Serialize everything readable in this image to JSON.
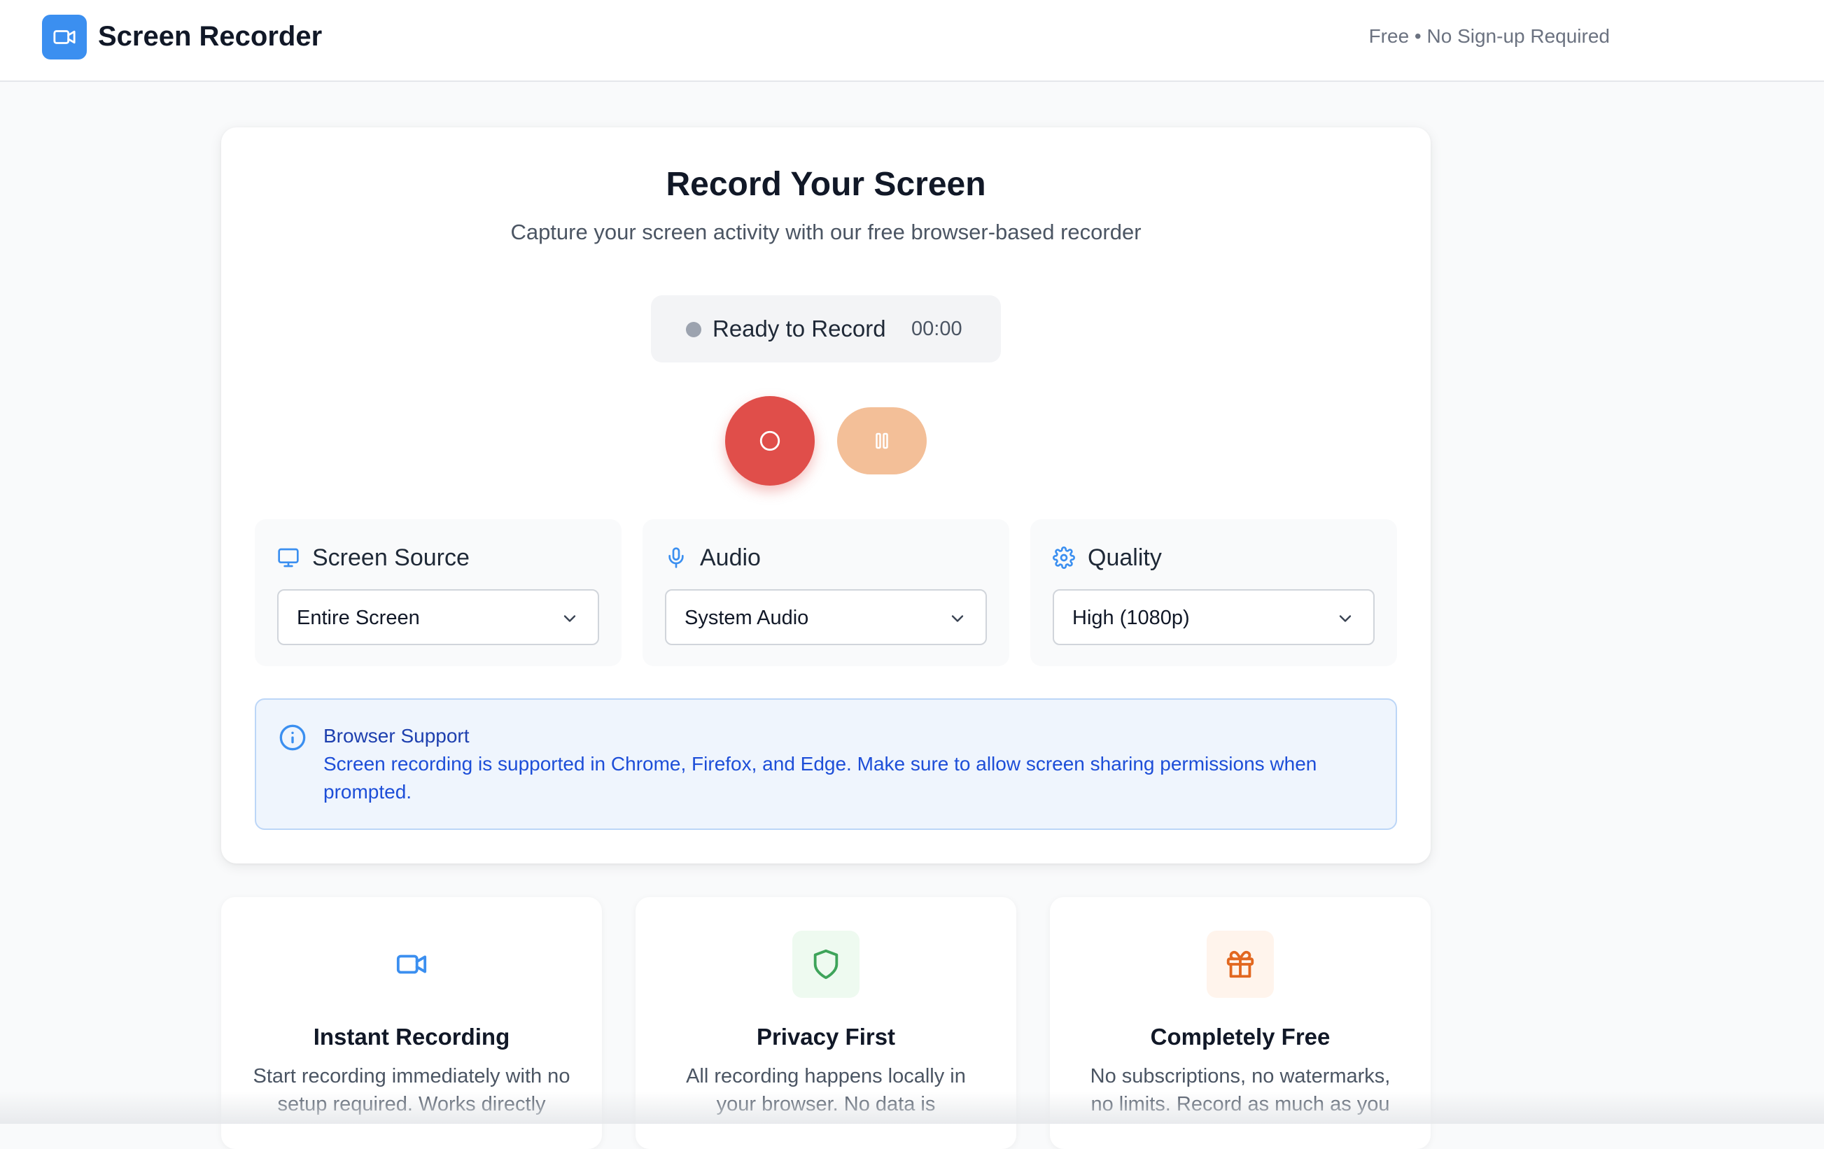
{
  "header": {
    "title": "Screen Recorder",
    "tagline": "Free • No Sign-up Required",
    "logo_icon": "video-camera-icon",
    "accent_color": "#3b8ff0"
  },
  "recorder": {
    "title": "Record Your Screen",
    "subtitle": "Capture your screen activity with our free browser-based recorder",
    "status": {
      "text": "Ready to Record",
      "time": "00:00"
    },
    "record_button_color": "#e04e4a",
    "pause_button_color": "#f3bf98"
  },
  "settings": [
    {
      "label": "Screen Source",
      "icon": "monitor-icon",
      "value": "Entire Screen"
    },
    {
      "label": "Audio",
      "icon": "microphone-icon",
      "value": "System Audio"
    },
    {
      "label": "Quality",
      "icon": "gear-icon",
      "value": "High (1080p)"
    }
  ],
  "info": {
    "title": "Browser Support",
    "body": "Screen recording is supported in Chrome, Firefox, and Edge. Make sure to allow screen sharing permissions when prompted."
  },
  "features": [
    {
      "title": "Instant Recording",
      "icon": "video-camera-icon",
      "description": "Start recording immediately with no setup required. Works directly"
    },
    {
      "title": "Privacy First",
      "icon": "shield-icon",
      "description": "All recording happens locally in your browser. No data is"
    },
    {
      "title": "Completely Free",
      "icon": "gift-icon",
      "description": "No subscriptions, no watermarks, no limits. Record as much as you"
    }
  ]
}
